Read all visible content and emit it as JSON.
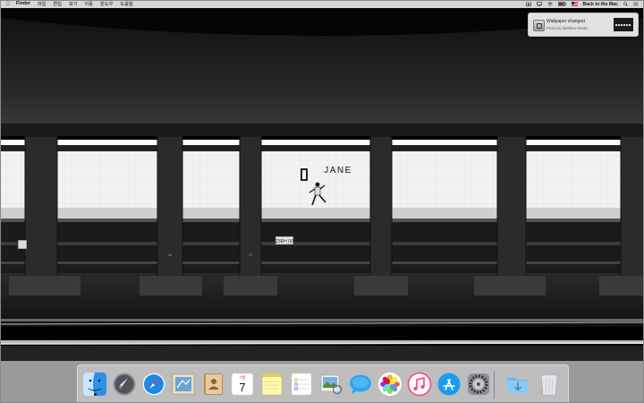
{
  "menubar": {
    "apple_icon": "apple-logo-icon",
    "items": [
      "Finder",
      "파일",
      "편집",
      "보기",
      "이동",
      "윈도우",
      "도움말"
    ],
    "status_icons": [
      "camera-icon",
      "screen-sharing-icon",
      "wifi-icon",
      "battery-icon",
      "flag-icon"
    ],
    "right_label": "Back to the Mac",
    "search_icon": "spotlight-search-icon",
    "notification_center_icon": "notification-center-icon"
  },
  "notification": {
    "title": "Wallpaper changed",
    "subtitle": "Photo by Matthew Wiebe"
  },
  "wallpaper": {
    "station_sign": "JANE",
    "track_sign": "23RH 00",
    "pillar_numbers": [
      "48",
      "47"
    ]
  },
  "dock": {
    "calendar_month": "7월",
    "calendar_day": "7",
    "apps": [
      "finder-icon",
      "launchpad-icon",
      "safari-icon",
      "mail-icon",
      "contacts-icon",
      "calendar-icon",
      "notes-icon",
      "reminders-icon",
      "preview-icon",
      "messages-icon",
      "photos-icon",
      "itunes-icon",
      "app-store-icon",
      "system-preferences-icon",
      "downloads-folder-icon",
      "trash-icon"
    ]
  },
  "colors": {
    "menubar_bg": "#e6e6e6",
    "safari_blue": "#1e88e5",
    "app_store_blue": "#1a9cf0",
    "itunes_pink": "#ff3e79"
  }
}
